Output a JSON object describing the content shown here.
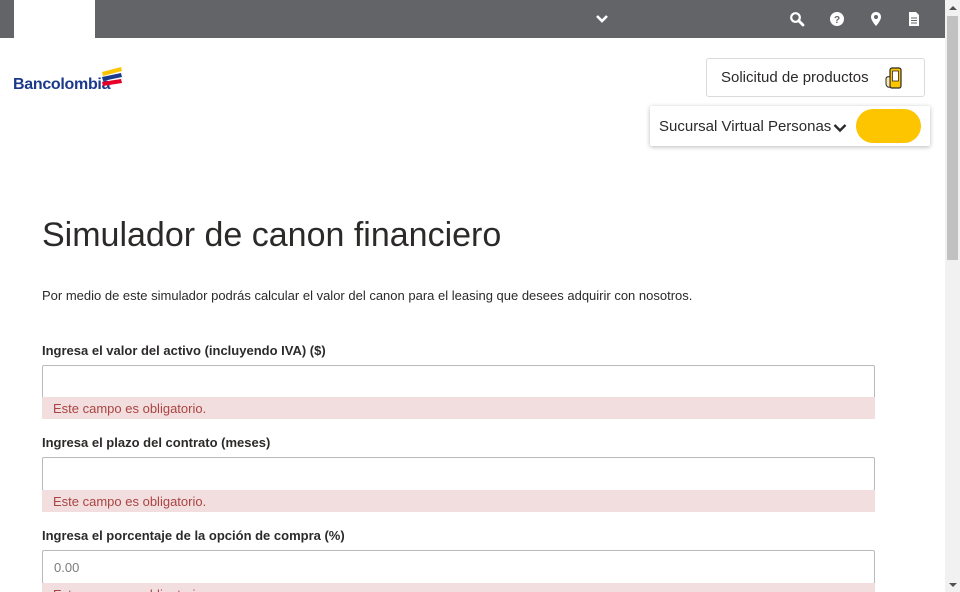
{
  "header": {
    "icons": [
      "chevron-down-icon",
      "search-icon",
      "help-icon",
      "location-icon",
      "document-icon"
    ]
  },
  "logo": {
    "text": "Bancolombia"
  },
  "product_request": {
    "label": "Solicitud de productos",
    "icon": "hand-phone-icon"
  },
  "branch": {
    "label": "Sucursal Virtual Personas"
  },
  "main": {
    "title": "Simulador de canon financiero",
    "intro": "Por medio de este simulador podrás calcular el valor del canon para el leasing que desees adquirir con nosotros.",
    "fields": [
      {
        "label": "Ingresa el valor del activo (incluyendo IVA) ($)",
        "value": "",
        "placeholder": "",
        "error": "Este campo es obligatorio."
      },
      {
        "label": "Ingresa el plazo del contrato (meses)",
        "value": "",
        "placeholder": "",
        "error": "Este campo es obligatorio."
      },
      {
        "label": "Ingresa el porcentaje de la opción de compra (%)",
        "value": "",
        "placeholder": "0.00",
        "error": "Este campo es obligatorio."
      }
    ]
  },
  "colors": {
    "topbar": "#636468",
    "accent_yellow": "#fdc500",
    "brand_blue": "#1b3a8c",
    "error_bg": "#f2dede",
    "error_text": "#a94442"
  }
}
